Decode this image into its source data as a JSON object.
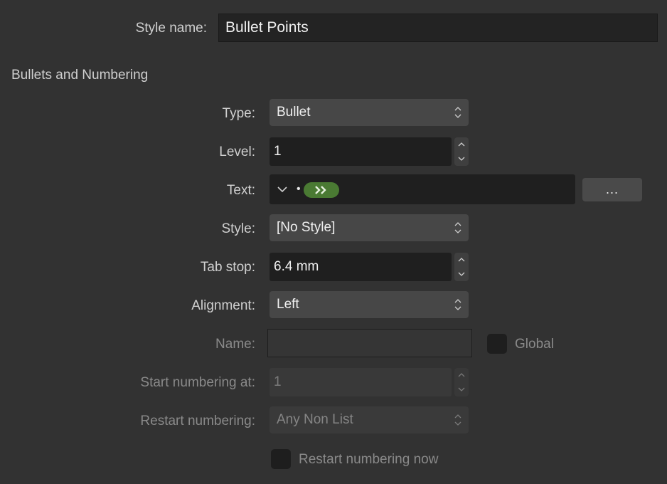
{
  "style_name": {
    "label": "Style name:",
    "value": "Bullet Points"
  },
  "section": {
    "title": "Bullets and Numbering"
  },
  "rows": {
    "type": {
      "label": "Type:",
      "value": "Bullet"
    },
    "level": {
      "label": "Level:",
      "value": "1"
    },
    "text": {
      "label": "Text:",
      "bullet_glyph": "•",
      "tab_token_icon": "double-chevron-right-icon",
      "browse_label": "..."
    },
    "style": {
      "label": "Style:",
      "value": "[No Style]"
    },
    "tab_stop": {
      "label": "Tab stop:",
      "value": "6.4 mm"
    },
    "alignment": {
      "label": "Alignment:",
      "value": "Left"
    },
    "name": {
      "label": "Name:",
      "value": ""
    },
    "global": {
      "label": "Global"
    },
    "start_numbering": {
      "label": "Start numbering at:",
      "value": "1"
    },
    "restart_numbering": {
      "label": "Restart numbering:",
      "value": "Any Non List"
    },
    "restart_now": {
      "label": "Restart numbering now"
    }
  },
  "colors": {
    "background": "#323232",
    "field_dark": "#1f1f1f",
    "select_bg": "#474747",
    "token_green": "#4a7a33"
  }
}
